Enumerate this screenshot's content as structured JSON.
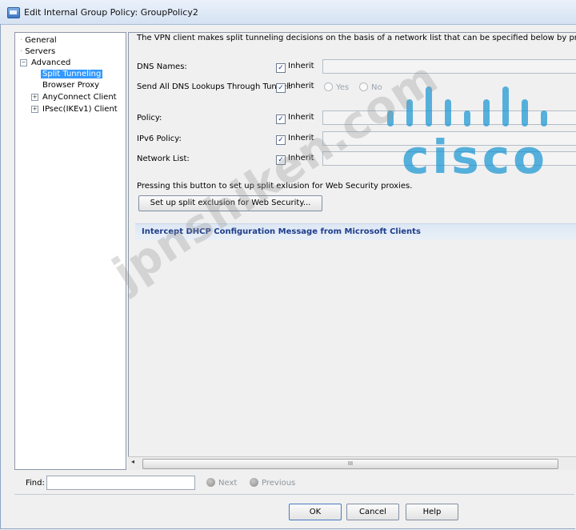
{
  "window": {
    "title": "Edit Internal Group Policy: GroupPolicy2"
  },
  "tree": {
    "general": "General",
    "servers": "Servers",
    "advanced": "Advanced",
    "split_tunneling": "Split Tunneling",
    "browser_proxy": "Browser Proxy",
    "anyconnect": "AnyConnect Client",
    "ipsec": "IPsec(IKEv1) Client"
  },
  "content": {
    "description": "The VPN client makes split tunneling decisions on the basis of a network list that can be specified below by providing the proper",
    "inherit_label": "Inherit",
    "dns_names": {
      "label": "DNS Names:"
    },
    "send_all_dns": {
      "label": "Send All DNS Lookups Through Tunnel:",
      "yes": "Yes",
      "no": "No"
    },
    "policy": {
      "label": "Policy:"
    },
    "ipv6_policy": {
      "label": "IPv6 Policy:"
    },
    "network_list": {
      "label": "Network List:"
    },
    "web_security_note": "Pressing this button to set up split exlusion for Web Security proxies.",
    "web_security_button": "Set up split exclusion for Web Security...",
    "intercept_dhcp": "Intercept DHCP Configuration Message from Microsoft Clients"
  },
  "scrollbar": {
    "grip": "III"
  },
  "footer": {
    "find_label": "Find:",
    "find_value": "",
    "next": "Next",
    "previous": "Previous",
    "ok": "OK",
    "cancel": "Cancel",
    "help": "Help"
  },
  "watermark": {
    "jpnshiken": "jpnshiken.com",
    "cisco": "cisco"
  }
}
